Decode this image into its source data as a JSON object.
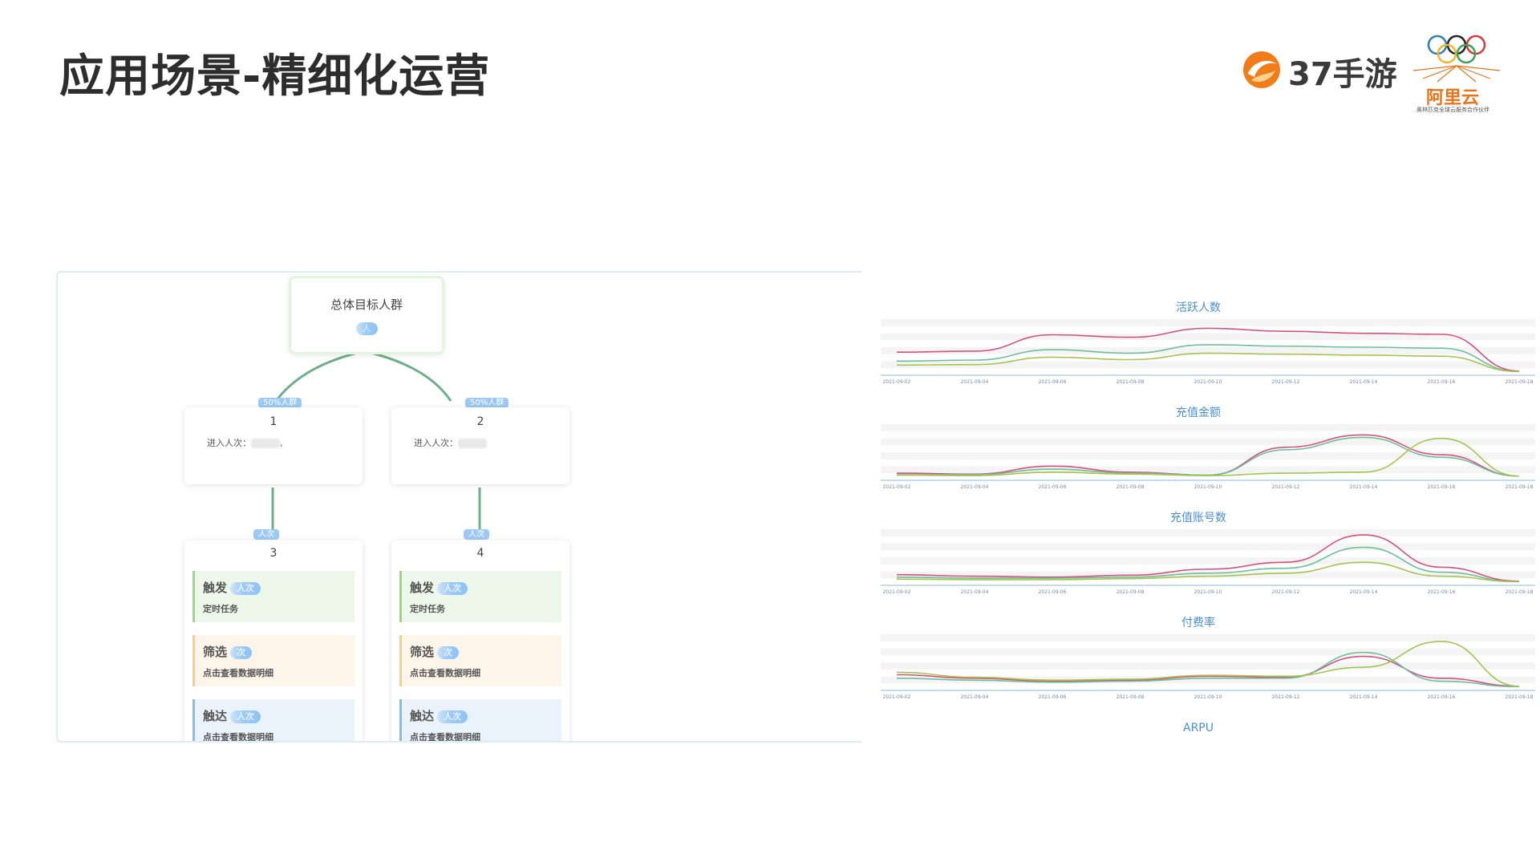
{
  "slide": {
    "title": "应用场景-精细化运营"
  },
  "logos": {
    "brand_37": "37手游",
    "aliyun": "阿里云",
    "aliyun_sub": "奥林匹克全球云服务合作伙伴",
    "colors": {
      "brand_orange": "#f07d1a",
      "aliyun_orange": "#e8741a"
    }
  },
  "flow": {
    "root": {
      "title": "总体目标人群",
      "count_suffix": "人"
    },
    "edge_label": "50%人群",
    "edge_count_suffix": "人次",
    "segments": [
      {
        "number": "1",
        "entry_label": "进入人次："
      },
      {
        "number": "2",
        "entry_label": "进入人次："
      }
    ],
    "step_nodes": [
      {
        "number": "3",
        "steps": [
          {
            "type": "trigger",
            "label": "触发",
            "suffix": "人次",
            "detail": "定时任务"
          },
          {
            "type": "filter",
            "label": "筛选",
            "suffix": "次",
            "detail": "点击查看数据明细"
          },
          {
            "type": "reach",
            "label": "触达",
            "suffix": "人次",
            "detail": "点击查看数据明细"
          }
        ]
      },
      {
        "number": "4",
        "steps": [
          {
            "type": "trigger",
            "label": "触发",
            "suffix": "人次",
            "detail": "定时任务"
          },
          {
            "type": "filter",
            "label": "筛选",
            "suffix": "次",
            "detail": "点击查看数据明细"
          },
          {
            "type": "reach",
            "label": "触达",
            "suffix": "人次",
            "detail": "点击查看数据明细"
          }
        ]
      }
    ]
  },
  "chart_data": [
    {
      "type": "line",
      "title": "活跃人数",
      "x": [
        "2021-09-02",
        "2021-09-04",
        "2021-09-06",
        "2021-09-08",
        "2021-09-10",
        "2021-09-12",
        "2021-09-14",
        "2021-09-16",
        "2021-09-18"
      ],
      "ylim": [
        0,
        100
      ],
      "series": [
        {
          "color": "#d9507f",
          "values": [
            40,
            42,
            75,
            70,
            88,
            82,
            78,
            76,
            2
          ]
        },
        {
          "color": "#6cbf9a",
          "values": [
            22,
            24,
            45,
            38,
            55,
            52,
            50,
            48,
            1
          ]
        },
        {
          "color": "#a6c44e",
          "values": [
            14,
            15,
            30,
            25,
            38,
            36,
            34,
            32,
            1
          ]
        }
      ]
    },
    {
      "type": "line",
      "title": "充值金额",
      "x": [
        "2021-09-02",
        "2021-09-04",
        "2021-09-06",
        "2021-09-08",
        "2021-09-10",
        "2021-09-12",
        "2021-09-14",
        "2021-09-16",
        "2021-09-18"
      ],
      "ylim": [
        0,
        100
      ],
      "series": [
        {
          "color": "#d9507f",
          "values": [
            8,
            6,
            22,
            10,
            4,
            60,
            85,
            45,
            2
          ]
        },
        {
          "color": "#6cbf9a",
          "values": [
            5,
            5,
            16,
            8,
            4,
            55,
            80,
            40,
            2
          ]
        },
        {
          "color": "#a6c44e",
          "values": [
            4,
            3,
            10,
            6,
            3,
            8,
            10,
            78,
            2
          ]
        }
      ]
    },
    {
      "type": "line",
      "title": "充值账号数",
      "x": [
        "2021-09-02",
        "2021-09-04",
        "2021-09-06",
        "2021-09-08",
        "2021-09-10",
        "2021-09-12",
        "2021-09-14",
        "2021-09-16",
        "2021-09-18"
      ],
      "ylim": [
        0,
        100
      ],
      "series": [
        {
          "color": "#d9507f",
          "values": [
            15,
            12,
            10,
            14,
            26,
            40,
            95,
            30,
            2
          ]
        },
        {
          "color": "#6cbf9a",
          "values": [
            10,
            8,
            8,
            10,
            18,
            28,
            70,
            20,
            1
          ]
        },
        {
          "color": "#a6c44e",
          "values": [
            6,
            5,
            5,
            7,
            12,
            18,
            40,
            12,
            1
          ]
        }
      ]
    },
    {
      "type": "line",
      "title": "付费率",
      "x": [
        "2021-09-02",
        "2021-09-04",
        "2021-09-06",
        "2021-09-08",
        "2021-09-10",
        "2021-09-12",
        "2021-09-14",
        "2021-09-16",
        "2021-09-18"
      ],
      "ylim": [
        0,
        100
      ],
      "series": [
        {
          "color": "#d9507f",
          "values": [
            25,
            18,
            12,
            14,
            22,
            20,
            62,
            18,
            2
          ]
        },
        {
          "color": "#6cbf9a",
          "values": [
            18,
            14,
            10,
            12,
            18,
            18,
            70,
            12,
            1
          ]
        },
        {
          "color": "#a6c44e",
          "values": [
            30,
            20,
            14,
            16,
            24,
            22,
            40,
            92,
            2
          ]
        }
      ]
    },
    {
      "type": "line",
      "title": "ARPU",
      "x": [],
      "series": []
    }
  ]
}
